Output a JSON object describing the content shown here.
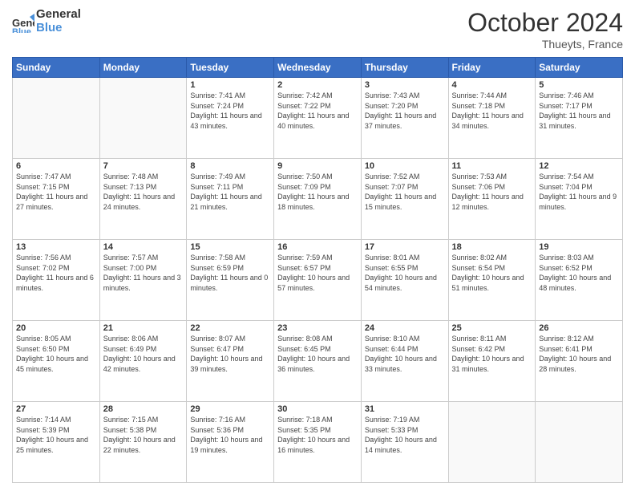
{
  "header": {
    "logo_line1": "General",
    "logo_line2": "Blue",
    "month": "October 2024",
    "location": "Thueyts, France"
  },
  "days_of_week": [
    "Sunday",
    "Monday",
    "Tuesday",
    "Wednesday",
    "Thursday",
    "Friday",
    "Saturday"
  ],
  "weeks": [
    [
      {
        "num": "",
        "empty": true
      },
      {
        "num": "",
        "empty": true
      },
      {
        "num": "1",
        "sunrise": "7:41 AM",
        "sunset": "7:24 PM",
        "daylight": "11 hours and 43 minutes."
      },
      {
        "num": "2",
        "sunrise": "7:42 AM",
        "sunset": "7:22 PM",
        "daylight": "11 hours and 40 minutes."
      },
      {
        "num": "3",
        "sunrise": "7:43 AM",
        "sunset": "7:20 PM",
        "daylight": "11 hours and 37 minutes."
      },
      {
        "num": "4",
        "sunrise": "7:44 AM",
        "sunset": "7:18 PM",
        "daylight": "11 hours and 34 minutes."
      },
      {
        "num": "5",
        "sunrise": "7:46 AM",
        "sunset": "7:17 PM",
        "daylight": "11 hours and 31 minutes."
      }
    ],
    [
      {
        "num": "6",
        "sunrise": "7:47 AM",
        "sunset": "7:15 PM",
        "daylight": "11 hours and 27 minutes."
      },
      {
        "num": "7",
        "sunrise": "7:48 AM",
        "sunset": "7:13 PM",
        "daylight": "11 hours and 24 minutes."
      },
      {
        "num": "8",
        "sunrise": "7:49 AM",
        "sunset": "7:11 PM",
        "daylight": "11 hours and 21 minutes."
      },
      {
        "num": "9",
        "sunrise": "7:50 AM",
        "sunset": "7:09 PM",
        "daylight": "11 hours and 18 minutes."
      },
      {
        "num": "10",
        "sunrise": "7:52 AM",
        "sunset": "7:07 PM",
        "daylight": "11 hours and 15 minutes."
      },
      {
        "num": "11",
        "sunrise": "7:53 AM",
        "sunset": "7:06 PM",
        "daylight": "11 hours and 12 minutes."
      },
      {
        "num": "12",
        "sunrise": "7:54 AM",
        "sunset": "7:04 PM",
        "daylight": "11 hours and 9 minutes."
      }
    ],
    [
      {
        "num": "13",
        "sunrise": "7:56 AM",
        "sunset": "7:02 PM",
        "daylight": "11 hours and 6 minutes."
      },
      {
        "num": "14",
        "sunrise": "7:57 AM",
        "sunset": "7:00 PM",
        "daylight": "11 hours and 3 minutes."
      },
      {
        "num": "15",
        "sunrise": "7:58 AM",
        "sunset": "6:59 PM",
        "daylight": "11 hours and 0 minutes."
      },
      {
        "num": "16",
        "sunrise": "7:59 AM",
        "sunset": "6:57 PM",
        "daylight": "10 hours and 57 minutes."
      },
      {
        "num": "17",
        "sunrise": "8:01 AM",
        "sunset": "6:55 PM",
        "daylight": "10 hours and 54 minutes."
      },
      {
        "num": "18",
        "sunrise": "8:02 AM",
        "sunset": "6:54 PM",
        "daylight": "10 hours and 51 minutes."
      },
      {
        "num": "19",
        "sunrise": "8:03 AM",
        "sunset": "6:52 PM",
        "daylight": "10 hours and 48 minutes."
      }
    ],
    [
      {
        "num": "20",
        "sunrise": "8:05 AM",
        "sunset": "6:50 PM",
        "daylight": "10 hours and 45 minutes."
      },
      {
        "num": "21",
        "sunrise": "8:06 AM",
        "sunset": "6:49 PM",
        "daylight": "10 hours and 42 minutes."
      },
      {
        "num": "22",
        "sunrise": "8:07 AM",
        "sunset": "6:47 PM",
        "daylight": "10 hours and 39 minutes."
      },
      {
        "num": "23",
        "sunrise": "8:08 AM",
        "sunset": "6:45 PM",
        "daylight": "10 hours and 36 minutes."
      },
      {
        "num": "24",
        "sunrise": "8:10 AM",
        "sunset": "6:44 PM",
        "daylight": "10 hours and 33 minutes."
      },
      {
        "num": "25",
        "sunrise": "8:11 AM",
        "sunset": "6:42 PM",
        "daylight": "10 hours and 31 minutes."
      },
      {
        "num": "26",
        "sunrise": "8:12 AM",
        "sunset": "6:41 PM",
        "daylight": "10 hours and 28 minutes."
      }
    ],
    [
      {
        "num": "27",
        "sunrise": "7:14 AM",
        "sunset": "5:39 PM",
        "daylight": "10 hours and 25 minutes."
      },
      {
        "num": "28",
        "sunrise": "7:15 AM",
        "sunset": "5:38 PM",
        "daylight": "10 hours and 22 minutes."
      },
      {
        "num": "29",
        "sunrise": "7:16 AM",
        "sunset": "5:36 PM",
        "daylight": "10 hours and 19 minutes."
      },
      {
        "num": "30",
        "sunrise": "7:18 AM",
        "sunset": "5:35 PM",
        "daylight": "10 hours and 16 minutes."
      },
      {
        "num": "31",
        "sunrise": "7:19 AM",
        "sunset": "5:33 PM",
        "daylight": "10 hours and 14 minutes."
      },
      {
        "num": "",
        "empty": true
      },
      {
        "num": "",
        "empty": true
      }
    ]
  ]
}
